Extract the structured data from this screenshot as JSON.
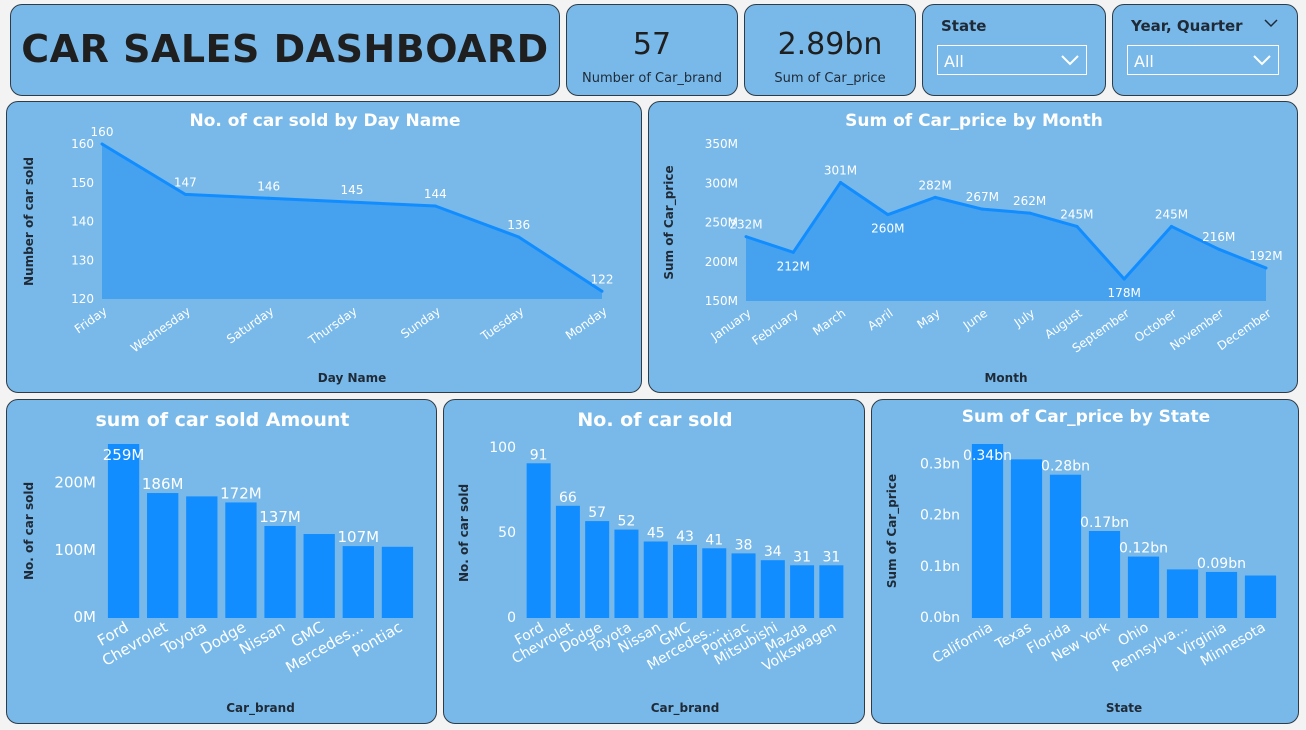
{
  "header": {
    "title": "CAR SALES DASHBOARD",
    "kpis": [
      {
        "value": "57",
        "label": "Number of Car_brand"
      },
      {
        "value": "2.89bn",
        "label": "Sum of Car_price"
      }
    ],
    "slicers": [
      {
        "label": "State",
        "value": "All"
      },
      {
        "label": "Year, Quarter",
        "value": "All"
      }
    ]
  },
  "colors": {
    "card_bg": "#78b9ea",
    "series": "#118dff",
    "area_fill": "#3d9eef",
    "text_dark": "#1f2a36"
  },
  "chart_data": [
    {
      "type": "area",
      "title": "No. of car sold by Day Name",
      "xlabel": "Day Name",
      "ylabel": "Number of car sold",
      "categories": [
        "Friday",
        "Wednesday",
        "Saturday",
        "Thursday",
        "Sunday",
        "Tuesday",
        "Monday"
      ],
      "values": [
        160,
        147,
        146,
        145,
        144,
        136,
        122
      ],
      "data_labels": [
        "160",
        "147",
        "146",
        "145",
        "144",
        "136",
        "122"
      ],
      "ylim": [
        120,
        160
      ],
      "yticks": [
        120,
        130,
        140,
        150,
        160
      ],
      "ytick_labels": [
        "120",
        "130",
        "140",
        "150",
        "160"
      ]
    },
    {
      "type": "area",
      "title": "Sum of Car_price by Month",
      "xlabel": "Month",
      "ylabel": "Sum of Car_price",
      "categories": [
        "January",
        "February",
        "March",
        "April",
        "May",
        "June",
        "July",
        "August",
        "September",
        "October",
        "November",
        "December"
      ],
      "values": [
        232,
        212,
        301,
        260,
        282,
        267,
        262,
        245,
        178,
        245,
        216,
        192
      ],
      "data_labels": [
        "232M",
        "212M",
        "301M",
        "260M",
        "282M",
        "267M",
        "262M",
        "245M",
        "178M",
        "245M",
        "216M",
        "192M"
      ],
      "ylim": [
        150,
        350
      ],
      "yticks": [
        150,
        200,
        250,
        300,
        350
      ],
      "ytick_labels": [
        "150M",
        "200M",
        "250M",
        "300M",
        "350M"
      ]
    },
    {
      "type": "bar",
      "title": "sum of car sold Amount",
      "xlabel": "Car_brand",
      "ylabel": "No. of car sold",
      "categories": [
        "Ford",
        "Chevrolet",
        "Toyota",
        "Dodge",
        "Nissan",
        "GMC",
        "Mercedes...",
        "Pontiac"
      ],
      "values": [
        259,
        186,
        181,
        172,
        137,
        125,
        107,
        106
      ],
      "data_labels": [
        "259M",
        "186M",
        "",
        "172M",
        "137M",
        "",
        "107M",
        ""
      ],
      "ylim": [
        0,
        259
      ],
      "yticks": [
        0,
        100,
        200
      ],
      "ytick_labels": [
        "0M",
        "100M",
        "200M"
      ]
    },
    {
      "type": "bar",
      "title": "No. of car sold",
      "xlabel": "Car_brand",
      "ylabel": "No. of car sold",
      "categories": [
        "Ford",
        "Chevrolet",
        "Dodge",
        "Toyota",
        "Nissan",
        "GMC",
        "Mercedes...",
        "Pontiac",
        "Mitsubishi",
        "Mazda",
        "Volkswagen"
      ],
      "values": [
        91,
        66,
        57,
        52,
        45,
        43,
        41,
        38,
        34,
        31,
        31
      ],
      "data_labels": [
        "91",
        "66",
        "57",
        "52",
        "45",
        "43",
        "41",
        "38",
        "34",
        "31",
        "31"
      ],
      "ylim": [
        0,
        100
      ],
      "yticks": [
        0,
        50,
        100
      ],
      "ytick_labels": [
        "0",
        "50",
        "100"
      ]
    },
    {
      "type": "bar",
      "title": "Sum of Car_price by State",
      "xlabel": "State",
      "ylabel": "Sum of Car_price",
      "categories": [
        "California",
        "Texas",
        "Florida",
        "New York",
        "Ohio",
        "Pennsylva...",
        "Virginia",
        "Minnesota"
      ],
      "values": [
        0.34,
        0.31,
        0.28,
        0.17,
        0.12,
        0.095,
        0.09,
        0.083
      ],
      "data_labels": [
        "0.34bn",
        "",
        "0.28bn",
        "0.17bn",
        "0.12bn",
        "",
        "0.09bn",
        ""
      ],
      "ylim": [
        0,
        0.34
      ],
      "yticks": [
        0,
        0.1,
        0.2,
        0.3
      ],
      "ytick_labels": [
        "0.0bn",
        "0.1bn",
        "0.2bn",
        "0.3bn"
      ]
    }
  ]
}
